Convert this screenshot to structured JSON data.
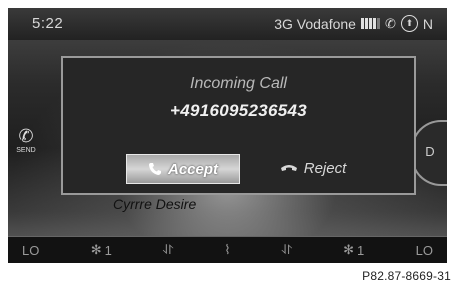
{
  "status": {
    "time": "5:22",
    "carrier": "3G Vodafone",
    "signal_bars": 4,
    "compass": "N",
    "icons": [
      "signal-strength-icon",
      "phone-icon",
      "compass-icon"
    ]
  },
  "background": {
    "text": "Cyrrre Desire",
    "left_button_label": "SEND",
    "right_button_label": "D"
  },
  "dialog": {
    "title": "Incoming Call",
    "number": "+4916095236543",
    "accept_label": "Accept",
    "reject_label": "Reject"
  },
  "climate": {
    "left_temp": "LO",
    "left_fan": "1",
    "right_fan": "1",
    "right_temp": "LO",
    "icons": [
      "fan-icon",
      "airflow-icon",
      "heat-icon",
      "airflow-icon",
      "fan-icon"
    ]
  },
  "caption": "P82.87-8669-31"
}
